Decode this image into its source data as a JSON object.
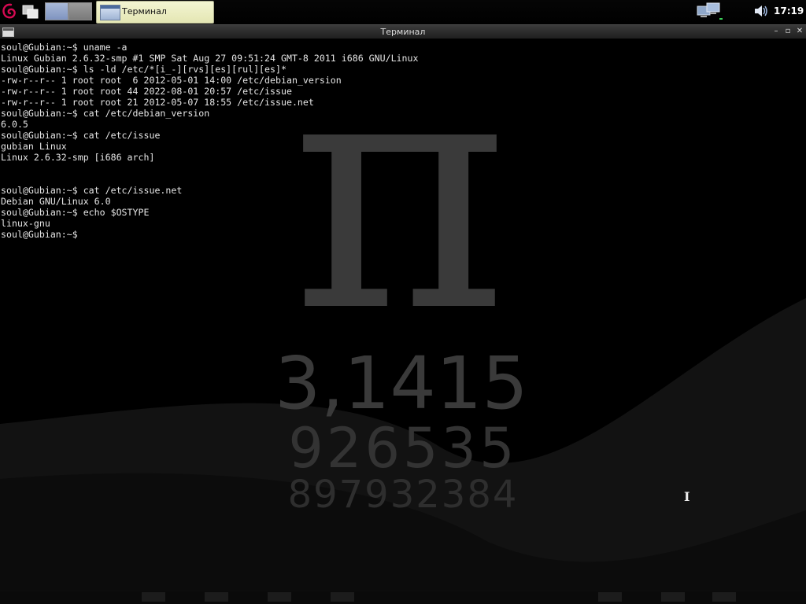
{
  "panel": {
    "task_title": "Терминал",
    "clock": "17:19",
    "icons": [
      "debian-swirl-icon",
      "show-desktop-icon",
      "network-icon",
      "volume-icon"
    ]
  },
  "window": {
    "title": "Терминал"
  },
  "terminal": {
    "lines": [
      "soul@Gubian:~$ uname -a",
      "Linux Gubian 2.6.32-smp #1 SMP Sat Aug 27 09:51:24 GMT-8 2011 i686 GNU/Linux",
      "soul@Gubian:~$ ls -ld /etc/*[i_-][rvs][es][rul][es]*",
      "-rw-r--r-- 1 root root  6 2012-05-01 14:00 /etc/debian_version",
      "-rw-r--r-- 1 root root 44 2022-08-01 20:57 /etc/issue",
      "-rw-r--r-- 1 root root 21 2012-05-07 18:55 /etc/issue.net",
      "soul@Gubian:~$ cat /etc/debian_version",
      "6.0.5",
      "soul@Gubian:~$ cat /etc/issue",
      "gubian Linux",
      "Linux 2.6.32-smp [i686 arch]",
      "",
      "",
      "soul@Gubian:~$ cat /etc/issue.net",
      "Debian GNU/Linux 6.0",
      "soul@Gubian:~$ echo $OSTYPE",
      "linux-gnu",
      "soul@Gubian:~$"
    ]
  },
  "wallpaper": {
    "symbol": "π",
    "digits_line1": "3,1415",
    "digits_line2": "926535",
    "digits_line3": "897932384"
  },
  "colors": {
    "terminal_bg": "#000000",
    "terminal_fg": "#e6e6e6",
    "wallpaper_art": "#3a3a3a"
  }
}
